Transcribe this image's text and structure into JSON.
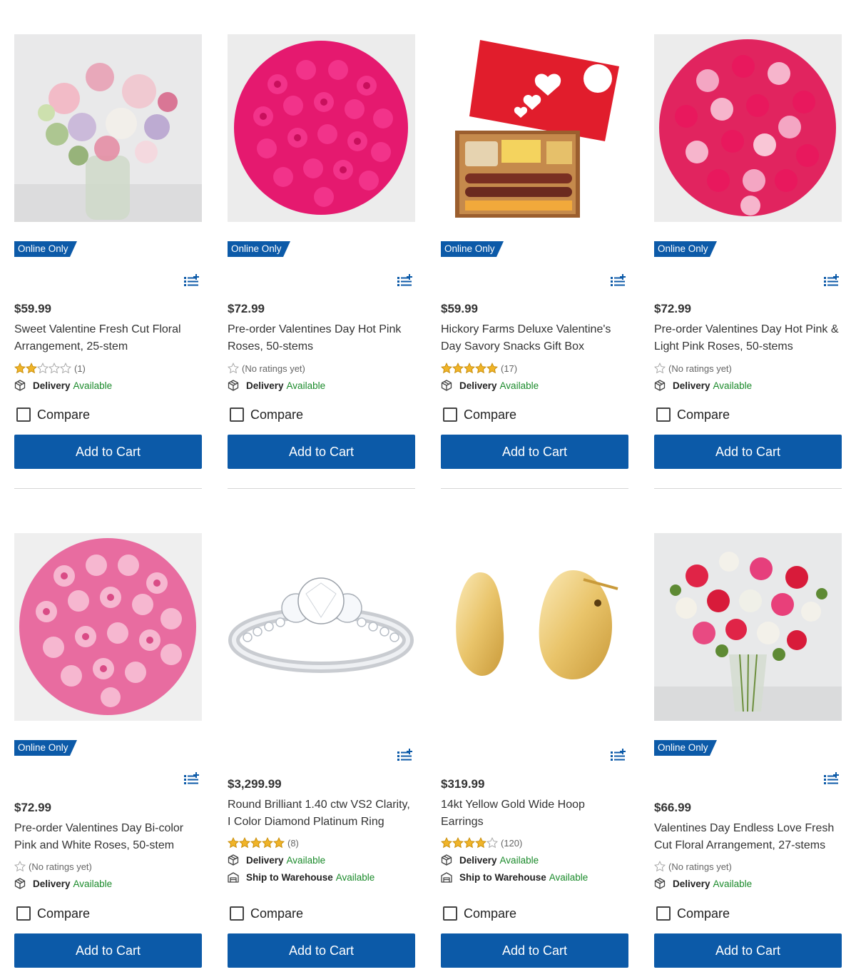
{
  "colors": {
    "accent_blue": "#0c5aa8",
    "available_green": "#1a8a2a",
    "star_gold": "#f0b429"
  },
  "labels": {
    "badge": "Online Only",
    "compare": "Compare",
    "add_to_cart": "Add to Cart",
    "delivery": "Delivery",
    "ship_to_warehouse": "Ship to Warehouse",
    "available": "Available"
  },
  "products": [
    {
      "image": "mixed-floral-vase",
      "badge": "Online Only",
      "price": "$59.99",
      "title": "Sweet Valentine Fresh Cut Floral Arrangement, 25-stem",
      "rating": 2,
      "rating_text": "(1)",
      "delivery": "Delivery",
      "delivery_status": "Available"
    },
    {
      "image": "hot-pink-roses",
      "badge": "Online Only",
      "price": "$72.99",
      "title": "Pre-order Valentines Day Hot Pink Roses, 50-stems",
      "rating": 0,
      "rating_text": "(No ratings yet)",
      "delivery": "Delivery",
      "delivery_status": "Available"
    },
    {
      "image": "snack-gift-box",
      "badge": "Online Only",
      "price": "$59.99",
      "title": "Hickory Farms Deluxe Valentine's Day Savory Snacks Gift Box",
      "rating": 5,
      "rating_text": "(17)",
      "delivery": "Delivery",
      "delivery_status": "Available"
    },
    {
      "image": "pink-light-pink-roses",
      "badge": "Online Only",
      "price": "$72.99",
      "title": "Pre-order Valentines Day Hot Pink & Light Pink Roses, 50-stems",
      "rating": 0,
      "rating_text": "(No ratings yet)",
      "delivery": "Delivery",
      "delivery_status": "Available"
    },
    {
      "image": "bicolor-roses",
      "badge": "Online Only",
      "price": "$72.99",
      "title": "Pre-order Valentines Day Bi-color Pink and White Roses, 50-stem",
      "rating": 0,
      "rating_text": "(No ratings yet)",
      "delivery": "Delivery",
      "delivery_status": "Available"
    },
    {
      "image": "diamond-ring",
      "badge": "",
      "price": "$3,299.99",
      "title": "Round Brilliant 1.40 ctw VS2 Clarity, I Color Diamond Platinum Ring",
      "rating": 5,
      "rating_text": "(8)",
      "delivery": "Delivery",
      "delivery_status": "Available",
      "warehouse": "Ship to Warehouse",
      "warehouse_status": "Available"
    },
    {
      "image": "gold-hoop-earrings",
      "badge": "",
      "price": "$319.99",
      "title": "14kt Yellow Gold Wide Hoop Earrings",
      "rating": 4,
      "rating_text": "(120)",
      "delivery": "Delivery",
      "delivery_status": "Available",
      "warehouse": "Ship to Warehouse",
      "warehouse_status": "Available"
    },
    {
      "image": "red-pink-white-roses-vase",
      "badge": "Online Only",
      "price": "$66.99",
      "title": "Valentines Day Endless Love Fresh Cut Floral Arrangement, 27-stems",
      "rating": 0,
      "rating_text": "(No ratings yet)",
      "delivery": "Delivery",
      "delivery_status": "Available"
    }
  ]
}
